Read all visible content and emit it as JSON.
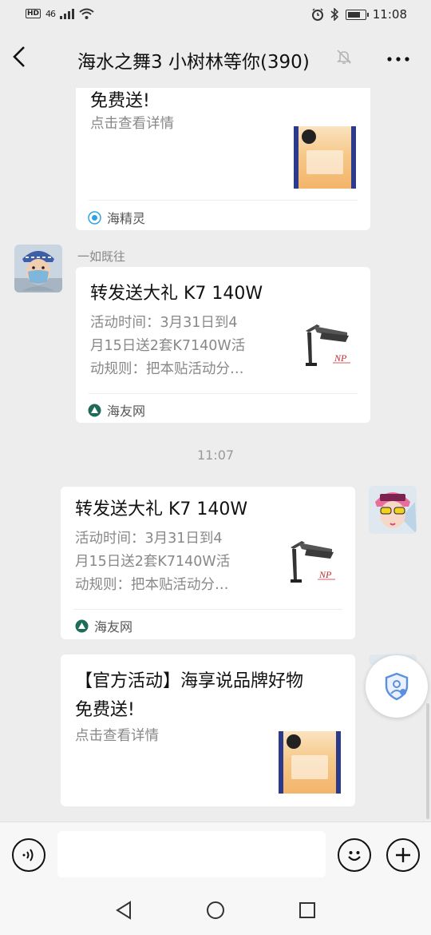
{
  "status": {
    "hd": "HD",
    "network": "46",
    "time": "11:08"
  },
  "header": {
    "title": "海水之舞3 小树林等你(390)",
    "back_icon": "chevron-left-icon",
    "mute_icon": "bell-off-icon",
    "more_icon": "more-dots-icon"
  },
  "messages": [
    {
      "title": "免费送!",
      "desc": "点击查看详情",
      "source": "海精灵",
      "source_color": "#2ea3e0"
    },
    {
      "sender": "一如既往",
      "title": "转发送大礼 K7 140W",
      "desc_lines": [
        "活动时间：3月31日到4",
        "月15日送2套K7140W活",
        "动规则：把本贴活动分…"
      ],
      "source": "海友网",
      "source_color": "#1f6b5a",
      "thumb_brand": "NP"
    },
    {
      "timestamp": "11:07"
    },
    {
      "title": "转发送大礼 K7 140W",
      "desc_lines": [
        "活动时间：3月31日到4",
        "月15日送2套K7140W活",
        "动规则：把本贴活动分…"
      ],
      "source": "海友网",
      "source_color": "#1f6b5a",
      "thumb_brand": "NP"
    },
    {
      "title_lines": [
        "【官方活动】海享说品牌好物",
        "免费送!"
      ],
      "desc": "点击查看详情"
    }
  ],
  "input": {
    "voice_icon": "voice-icon",
    "emoji_icon": "emoji-icon",
    "plus_icon": "plus-icon",
    "placeholder": ""
  },
  "nav": [
    "back-triangle-icon",
    "home-circle-icon",
    "recents-square-icon"
  ],
  "colors": {
    "background": "#ededed",
    "card": "#ffffff",
    "secondary_text": "#888888"
  }
}
